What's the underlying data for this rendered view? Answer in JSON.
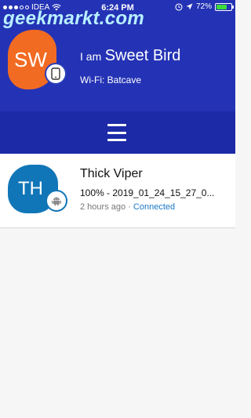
{
  "status_bar": {
    "carrier": "IDEA",
    "time": "6:24 PM",
    "battery_percent": "72%",
    "battery_level": 0.72
  },
  "watermark": "geekmarkt.com",
  "self": {
    "initials": "SW",
    "title_prefix": "I am",
    "name": "Sweet Bird",
    "wifi": "Wi-Fi: Batcave",
    "avatar_color": "#f26b22",
    "device_icon": "phone-icon"
  },
  "menu": {
    "icon": "hamburger-menu-icon"
  },
  "devices": [
    {
      "initials": "TH",
      "name": "Thick Viper",
      "progress_text": "100% - 2019_01_24_15_27_0...",
      "time_ago": "2 hours ago",
      "separator": "·",
      "status": "Connected",
      "avatar_color": "#1176b8",
      "device_icon": "android-icon"
    }
  ],
  "colors": {
    "header_bg": "#2433b5",
    "menubar_bg": "#1c2aa8",
    "connected": "#1a78c8"
  }
}
